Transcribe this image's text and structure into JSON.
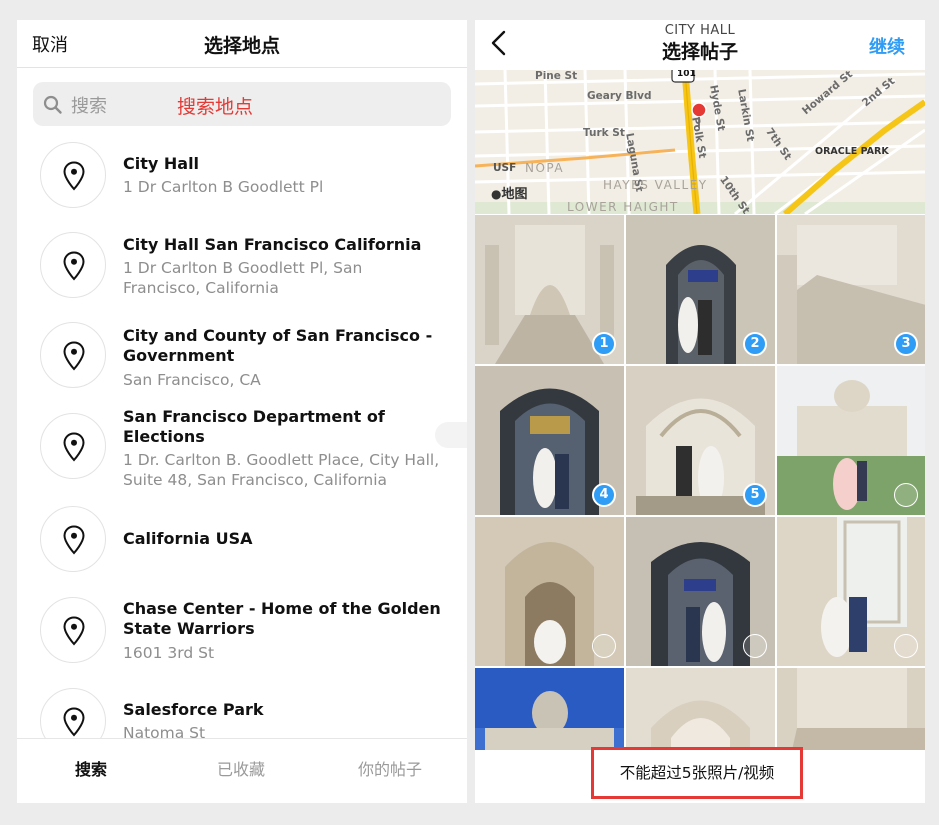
{
  "left": {
    "cancel": "取消",
    "title": "选择地点",
    "search": {
      "placeholder": "搜索",
      "annotation": "搜索地点"
    },
    "places": [
      {
        "name": "City Hall",
        "address": "1 Dr Carlton B Goodlett Pl"
      },
      {
        "name": "City Hall San Francisco California",
        "address": "1 Dr Carlton B Goodlett Pl, San Francisco, California"
      },
      {
        "name": "City and County of San Francisco - Government",
        "address": "San Francisco, CA"
      },
      {
        "name": "San Francisco Department of Elections",
        "address": "1 Dr. Carlton B. Goodlett Place, City Hall, Suite 48, San Francisco, California"
      },
      {
        "name": "California USA",
        "address": ""
      },
      {
        "name": "Chase Center - Home of the Golden State Warriors",
        "address": "1601 3rd St"
      },
      {
        "name": "Salesforce Park",
        "address": "Natoma St"
      }
    ],
    "tabs": [
      {
        "label": "搜索",
        "active": true
      },
      {
        "label": "已收藏",
        "active": false
      },
      {
        "label": "你的帖子",
        "active": false
      }
    ]
  },
  "right": {
    "subtitle": "CITY HALL",
    "title": "选择帖子",
    "continue": "继续",
    "map": {
      "brand": "地图",
      "labels": [
        "Pine St",
        "Geary Blvd",
        "Turk St",
        "Laguna St",
        "Hyde St",
        "Polk St",
        "Larkin St",
        "7th St",
        "10th St",
        "Howard St",
        "2nd St",
        "ORACLE PARK",
        "101",
        "USF"
      ],
      "areas": [
        "NOPA",
        "HAYES VALLEY",
        "LOWER HAIGHT"
      ]
    },
    "grid": [
      {
        "scene": "interior-stair",
        "selected": 1
      },
      {
        "scene": "door-couple",
        "selected": 2
      },
      {
        "scene": "stair-wide",
        "selected": 3
      },
      {
        "scene": "door-couple",
        "selected": 4
      },
      {
        "scene": "arch-couple",
        "selected": 5
      },
      {
        "scene": "exterior-dome",
        "selected": null
      },
      {
        "scene": "arch-hall",
        "selected": null
      },
      {
        "scene": "door-couple",
        "selected": null
      },
      {
        "scene": "window-couple",
        "selected": null
      },
      {
        "scene": "sky-dome",
        "selected": null
      },
      {
        "scene": "arch-hall",
        "selected": null
      },
      {
        "scene": "stair-wide",
        "selected": null
      }
    ],
    "notice": "不能超过5张照片/视频"
  },
  "colors": {
    "accent": "#2f9cf5",
    "annotation_red": "#e53935"
  }
}
